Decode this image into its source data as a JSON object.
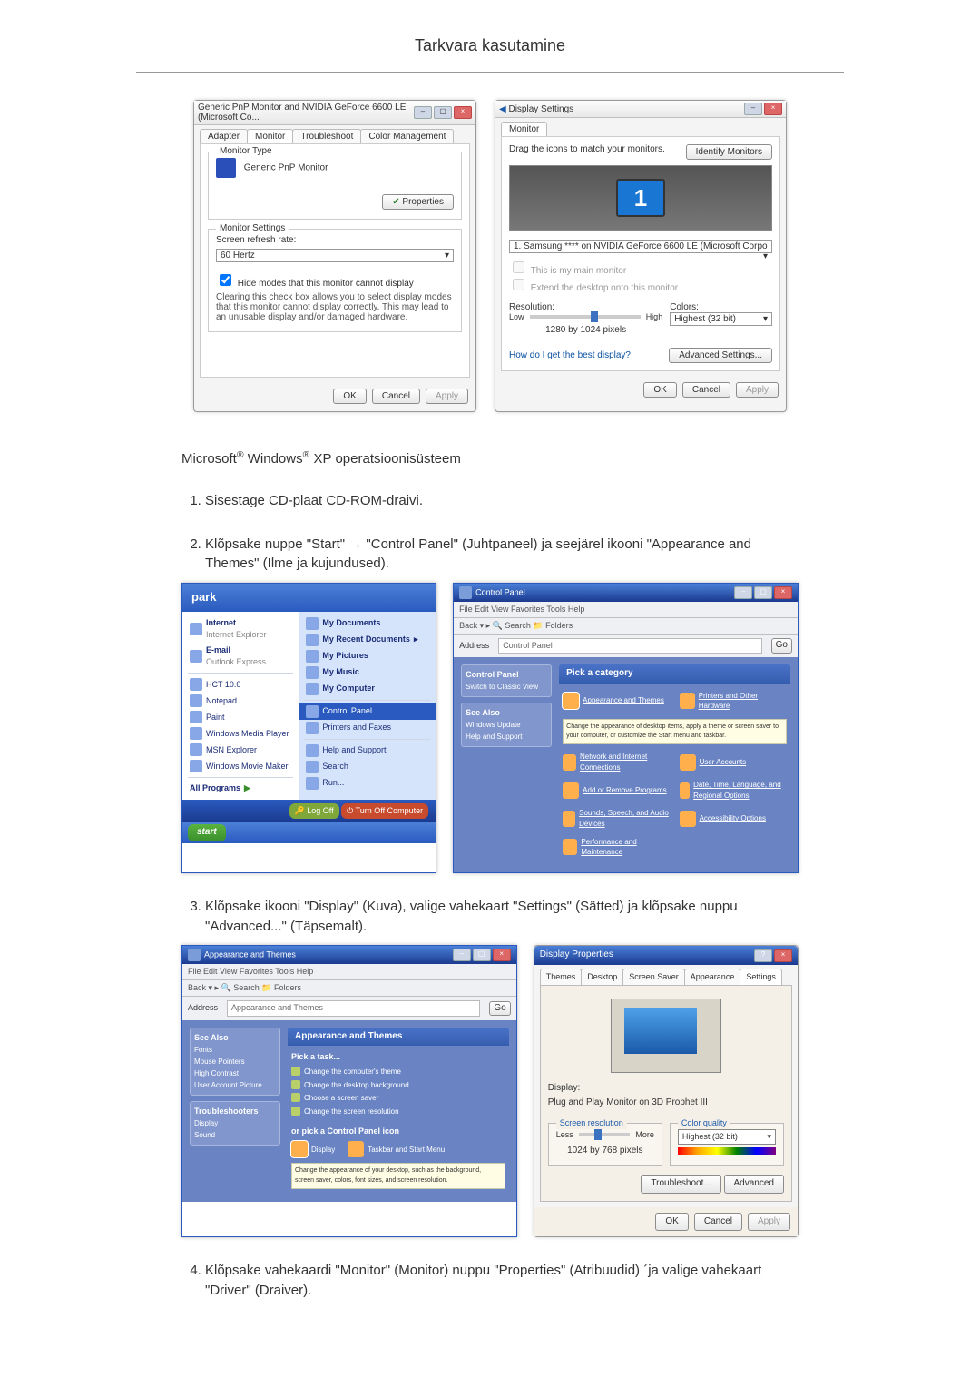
{
  "header": "Tarkvara kasutamine",
  "dlg_left": {
    "title": "Generic PnP Monitor and NVIDIA GeForce 6600 LE (Microsoft Co...",
    "tabs": [
      "Adapter",
      "Monitor",
      "Troubleshoot",
      "Color Management"
    ],
    "active_tab": 1,
    "monitor_type_legend": "Monitor Type",
    "monitor_type_value": "Generic PnP Monitor",
    "properties_btn": "Properties",
    "monitor_settings_legend": "Monitor Settings",
    "refresh_label": "Screen refresh rate:",
    "refresh_value": "60 Hertz",
    "hide_modes_label": "Hide modes that this monitor cannot display",
    "hide_modes_desc": "Clearing this check box allows you to select display modes that this monitor cannot display correctly. This may lead to an unusable display and/or damaged hardware.",
    "ok": "OK",
    "cancel": "Cancel",
    "apply": "Apply"
  },
  "dlg_right": {
    "title": "Display Settings",
    "tab": "Monitor",
    "drag_text": "Drag the icons to match your monitors.",
    "identify_btn": "Identify Monitors",
    "dropdown": "1. Samsung **** on NVIDIA GeForce 6600 LE (Microsoft Corpo",
    "main_monitor": "This is my main monitor",
    "extend": "Extend the desktop onto this monitor",
    "resolution_label": "Resolution:",
    "low": "Low",
    "high": "High",
    "res_value": "1280 by 1024 pixels",
    "colors_label": "Colors:",
    "colors_value": "Highest (32 bit)",
    "best_display_link": "How do I get the best display?",
    "advanced_btn": "Advanced Settings...",
    "ok": "OK",
    "cancel": "Cancel",
    "apply": "Apply"
  },
  "os_line_prefix": "Microsoft",
  "os_line_middle": " Windows",
  "os_line_suffix": " XP operatsioonisüsteem",
  "steps": [
    "Sisestage CD-plaat CD-ROM-draivi.",
    "Klõpsake nuppe \"Start\" → \"Control Panel\" (Juhtpaneel) ja seejärel ikooni \"Appearance and Themes\" (Ilme ja kujundused).",
    "Klõpsake ikooni \"Display\" (Kuva), valige vahekaart \"Settings\" (Sätted) ja klõpsake nuppu \"Advanced...\" (Täpsemalt).",
    "Klõpsake vahekaardi \"Monitor\" (Monitor) nuppu \"Properties\" (Atribuudid) ´ja valige vahekaart \"Driver\" (Draiver)."
  ],
  "startmenu": {
    "user": "park",
    "left": [
      {
        "title": "Internet",
        "sub": "Internet Explorer"
      },
      {
        "title": "E-mail",
        "sub": "Outlook Express"
      },
      {
        "title": "HCT 10.0"
      },
      {
        "title": "Notepad"
      },
      {
        "title": "Paint"
      },
      {
        "title": "Windows Media Player"
      },
      {
        "title": "MSN Explorer"
      },
      {
        "title": "Windows Movie Maker"
      }
    ],
    "all_programs": "All Programs",
    "right": [
      "My Documents",
      "My Recent Documents",
      "My Pictures",
      "My Music",
      "My Computer",
      "Control Panel",
      "Printers and Faxes",
      "Help and Support",
      "Search",
      "Run..."
    ],
    "highlight_index": 5,
    "logoff": "Log Off",
    "turnoff": "Turn Off Computer",
    "start": "start"
  },
  "controlpanel": {
    "title": "Control Panel",
    "menu": "File  Edit  View  Favorites  Tools  Help",
    "toolbar": "Back  ▾   ▸   🔍 Search   📁 Folders",
    "address_label": "Address",
    "address_value": "Control Panel",
    "side1_title": "Control Panel",
    "side1_item": "Switch to Classic View",
    "side2_title": "See Also",
    "side2_items": [
      "Windows Update",
      "Help and Support"
    ],
    "pick_category": "Pick a category",
    "categories": [
      "Appearance and Themes",
      "Printers and Other Hardware",
      "Network and Internet Connections",
      "User Accounts",
      "Add or Remove Programs",
      "Date, Time, Language, and Regional Options",
      "Sounds, Speech, and Audio Devices",
      "Accessibility Options",
      "Performance and Maintenance"
    ],
    "highlight_index": 0,
    "tooltip": "Change the appearance of desktop items, apply a theme or screen saver to your computer, or customize the Start menu and taskbar."
  },
  "appearance_window": {
    "title": "Appearance and Themes",
    "menu": "File  Edit  View  Favorites  Tools  Help",
    "toolbar": "Back  ▾   ▸   🔍 Search   📁 Folders",
    "address_value": "Appearance and Themes",
    "side1_title": "See Also",
    "side1_items": [
      "Fonts",
      "Mouse Pointers",
      "High Contrast",
      "User Account Picture"
    ],
    "side2_title": "Troubleshooters",
    "side2_items": [
      "Display",
      "Sound"
    ],
    "main_head": "Appearance and Themes",
    "pick_task": "Pick a task...",
    "tasks": [
      "Change the computer's theme",
      "Change the desktop background",
      "Choose a screen saver",
      "Change the screen resolution"
    ],
    "pick_icon": "or pick a Control Panel icon",
    "cp_icons": [
      "Display",
      "Taskbar and Start Menu"
    ],
    "display_tooltip": "Change the appearance of your desktop, such as the background, screen saver, colors, font sizes, and screen resolution."
  },
  "display_props": {
    "title": "Display Properties",
    "tabs": [
      "Themes",
      "Desktop",
      "Screen Saver",
      "Appearance",
      "Settings"
    ],
    "active_tab": 4,
    "display_label": "Display:",
    "display_value": "Plug and Play Monitor on 3D Prophet III",
    "res_legend": "Screen resolution",
    "less": "Less",
    "more": "More",
    "res_value": "1024 by 768 pixels",
    "color_legend": "Color quality",
    "color_value": "Highest (32 bit)",
    "troubleshoot": "Troubleshoot...",
    "advanced": "Advanced",
    "ok": "OK",
    "cancel": "Cancel",
    "apply": "Apply"
  }
}
